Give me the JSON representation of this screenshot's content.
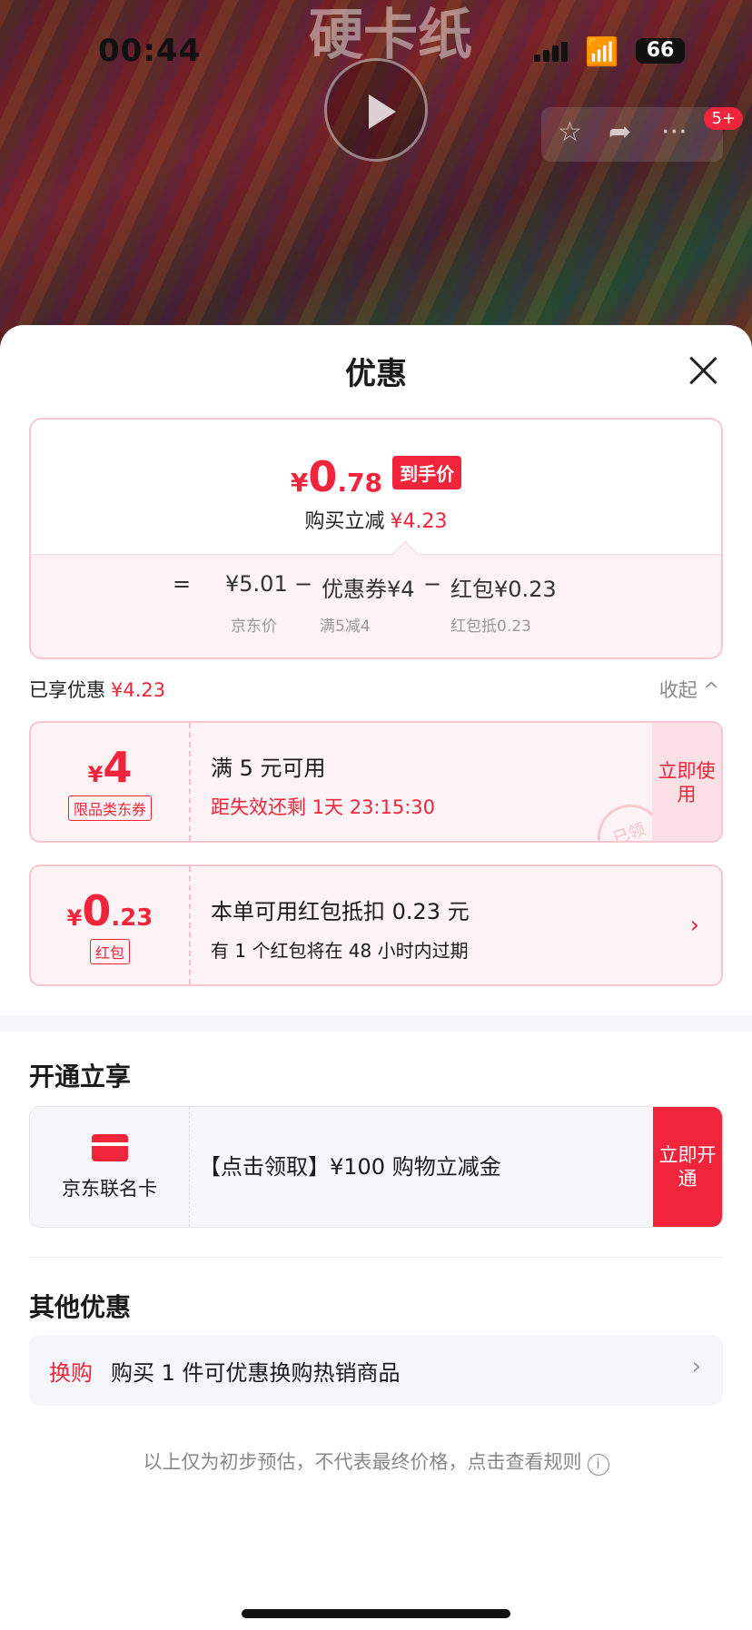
{
  "background": {
    "title_fragment": "硬卡纸",
    "badge": "5+"
  },
  "status_bar": {
    "time": "00:44",
    "battery": "66"
  },
  "sheet": {
    "title": "优惠",
    "price": {
      "yen": "¥",
      "integer": "0",
      "decimal": ".78",
      "tag": "到手价",
      "save_label": "购买立减",
      "save_amount": "¥4.23"
    },
    "formula": {
      "eq": "=",
      "jd_price": "¥5.01",
      "minus1": "−",
      "coupon": "优惠券¥4",
      "minus2": "−",
      "redpacket": "红包¥0.23",
      "jd_price_label": "京东价",
      "coupon_label": "满5减4",
      "redpacket_label": "红包抵0.23"
    },
    "enjoyed": {
      "label": "已享优惠",
      "amount": "¥4.23",
      "collapse": "收起 ^"
    },
    "coupon1": {
      "yen": "¥",
      "amount": "4",
      "tag": "限品类东券",
      "line1": "满 5 元可用",
      "line2": "距失效还剩 1天 23:15:30",
      "button": "立即使用",
      "stamp": "已领"
    },
    "coupon2": {
      "yen": "¥",
      "amount": "0",
      "decimal": ".23",
      "tag": "红包",
      "line1": "本单可用红包抵扣 0.23 元",
      "line2": "有 1 个红包将在 48 小时内过期"
    },
    "open_section": {
      "title": "开通立享",
      "brand": "京东联名卡",
      "text": "【点击领取】¥100 购物立减金",
      "button": "立即开通"
    },
    "other_section": {
      "title": "其他优惠",
      "tag": "换购",
      "text": "购买 1 件可优惠换购热销商品"
    },
    "disclaimer": "以上仅为初步预估，不代表最终价格，点击查看规则"
  },
  "colors": {
    "accent": "#f0243a",
    "pink_bg": "#fdf3f5"
  }
}
